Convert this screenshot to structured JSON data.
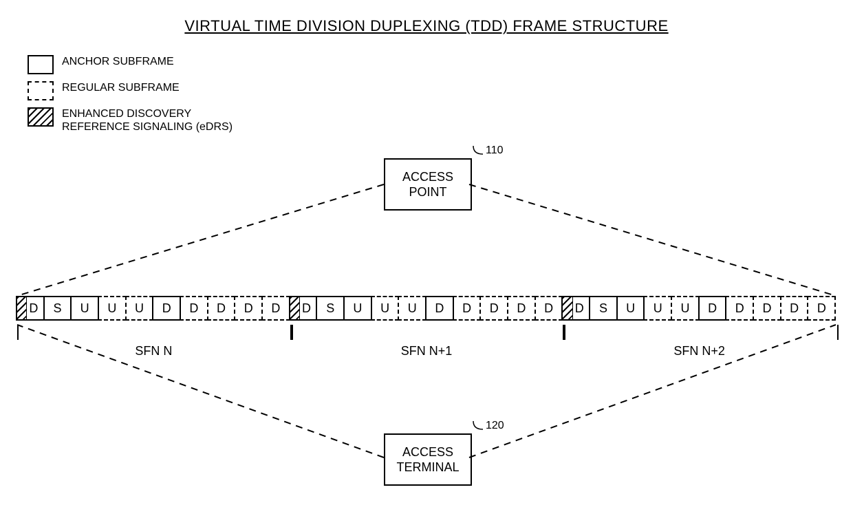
{
  "title": "VIRTUAL TIME DIVISION DUPLEXING (TDD) FRAME STRUCTURE",
  "legend": {
    "anchor": "ANCHOR SUBFRAME",
    "regular": "REGULAR SUBFRAME",
    "edrs_l1": "ENHANCED DISCOVERY",
    "edrs_l2": "REFERENCE SIGNALING (eDRS)"
  },
  "nodes": {
    "ap": {
      "label_l1": "ACCESS",
      "label_l2": "POINT",
      "ref": "110"
    },
    "at": {
      "label_l1": "ACCESS",
      "label_l2": "TERMINAL",
      "ref": "120"
    }
  },
  "frame_pattern": [
    {
      "t": "D",
      "style": "anchor",
      "hatch": true
    },
    {
      "t": "S",
      "style": "anchor"
    },
    {
      "t": "U",
      "style": "anchor"
    },
    {
      "t": "U",
      "style": "regular"
    },
    {
      "t": "U",
      "style": "regular"
    },
    {
      "t": "D",
      "style": "anchor"
    },
    {
      "t": "D",
      "style": "regular"
    },
    {
      "t": "D",
      "style": "regular"
    },
    {
      "t": "D",
      "style": "regular"
    },
    {
      "t": "D",
      "style": "regular"
    }
  ],
  "sfn_labels": [
    "SFN N",
    "SFN N+1",
    "SFN N+2"
  ],
  "sfn_count": 3
}
